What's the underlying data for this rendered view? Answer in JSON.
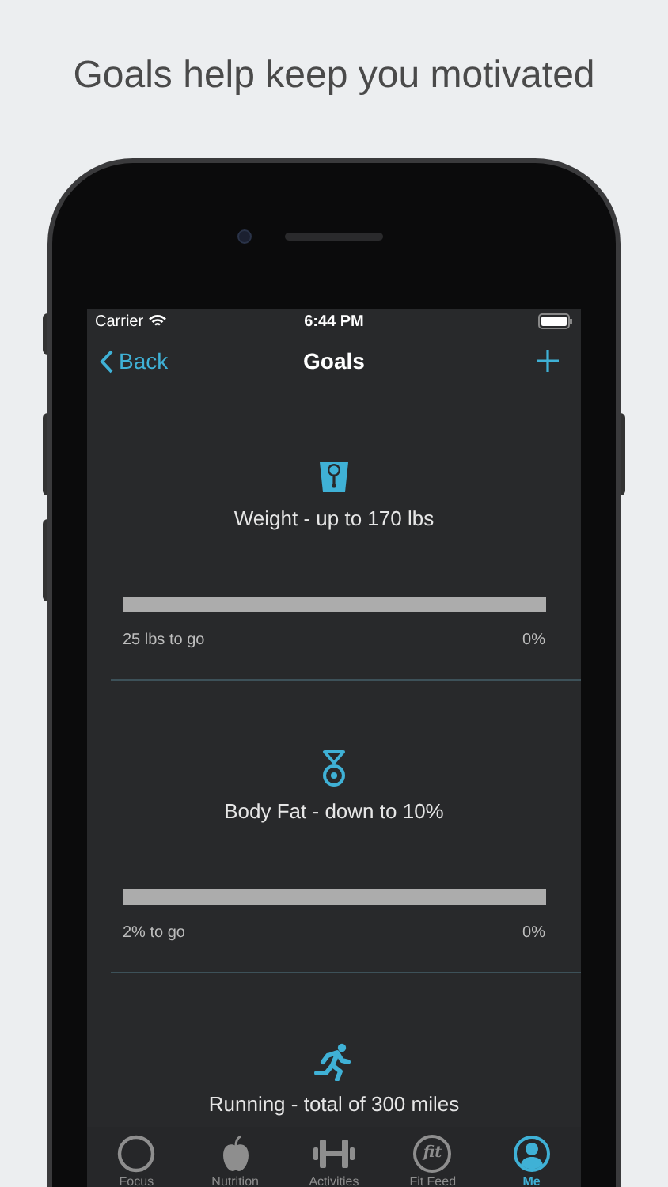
{
  "headline": "Goals help keep you motivated",
  "status_bar": {
    "carrier": "Carrier",
    "time": "6:44 PM"
  },
  "nav": {
    "back": "Back",
    "title": "Goals"
  },
  "goals": [
    {
      "kind": "weight",
      "title": "Weight - up to 170 lbs",
      "level": 0,
      "remaining": "25 lbs to go",
      "percent": "0%"
    },
    {
      "kind": "bodyfat",
      "title": "Body Fat - down to 10%",
      "level": 0,
      "remaining": "2% to go",
      "percent": "0%"
    },
    {
      "kind": "running",
      "title": "Running - total of 300 miles"
    }
  ],
  "tabs": [
    {
      "kind": "focus",
      "label": "Focus",
      "selected": false
    },
    {
      "kind": "nutrition",
      "label": "Nutrition",
      "selected": false
    },
    {
      "kind": "activities",
      "label": "Activities",
      "selected": false
    },
    {
      "kind": "feed",
      "label": "Fit Feed",
      "glyph": "fit",
      "selected": false
    },
    {
      "kind": "me",
      "label": "Me",
      "selected": true
    }
  ]
}
